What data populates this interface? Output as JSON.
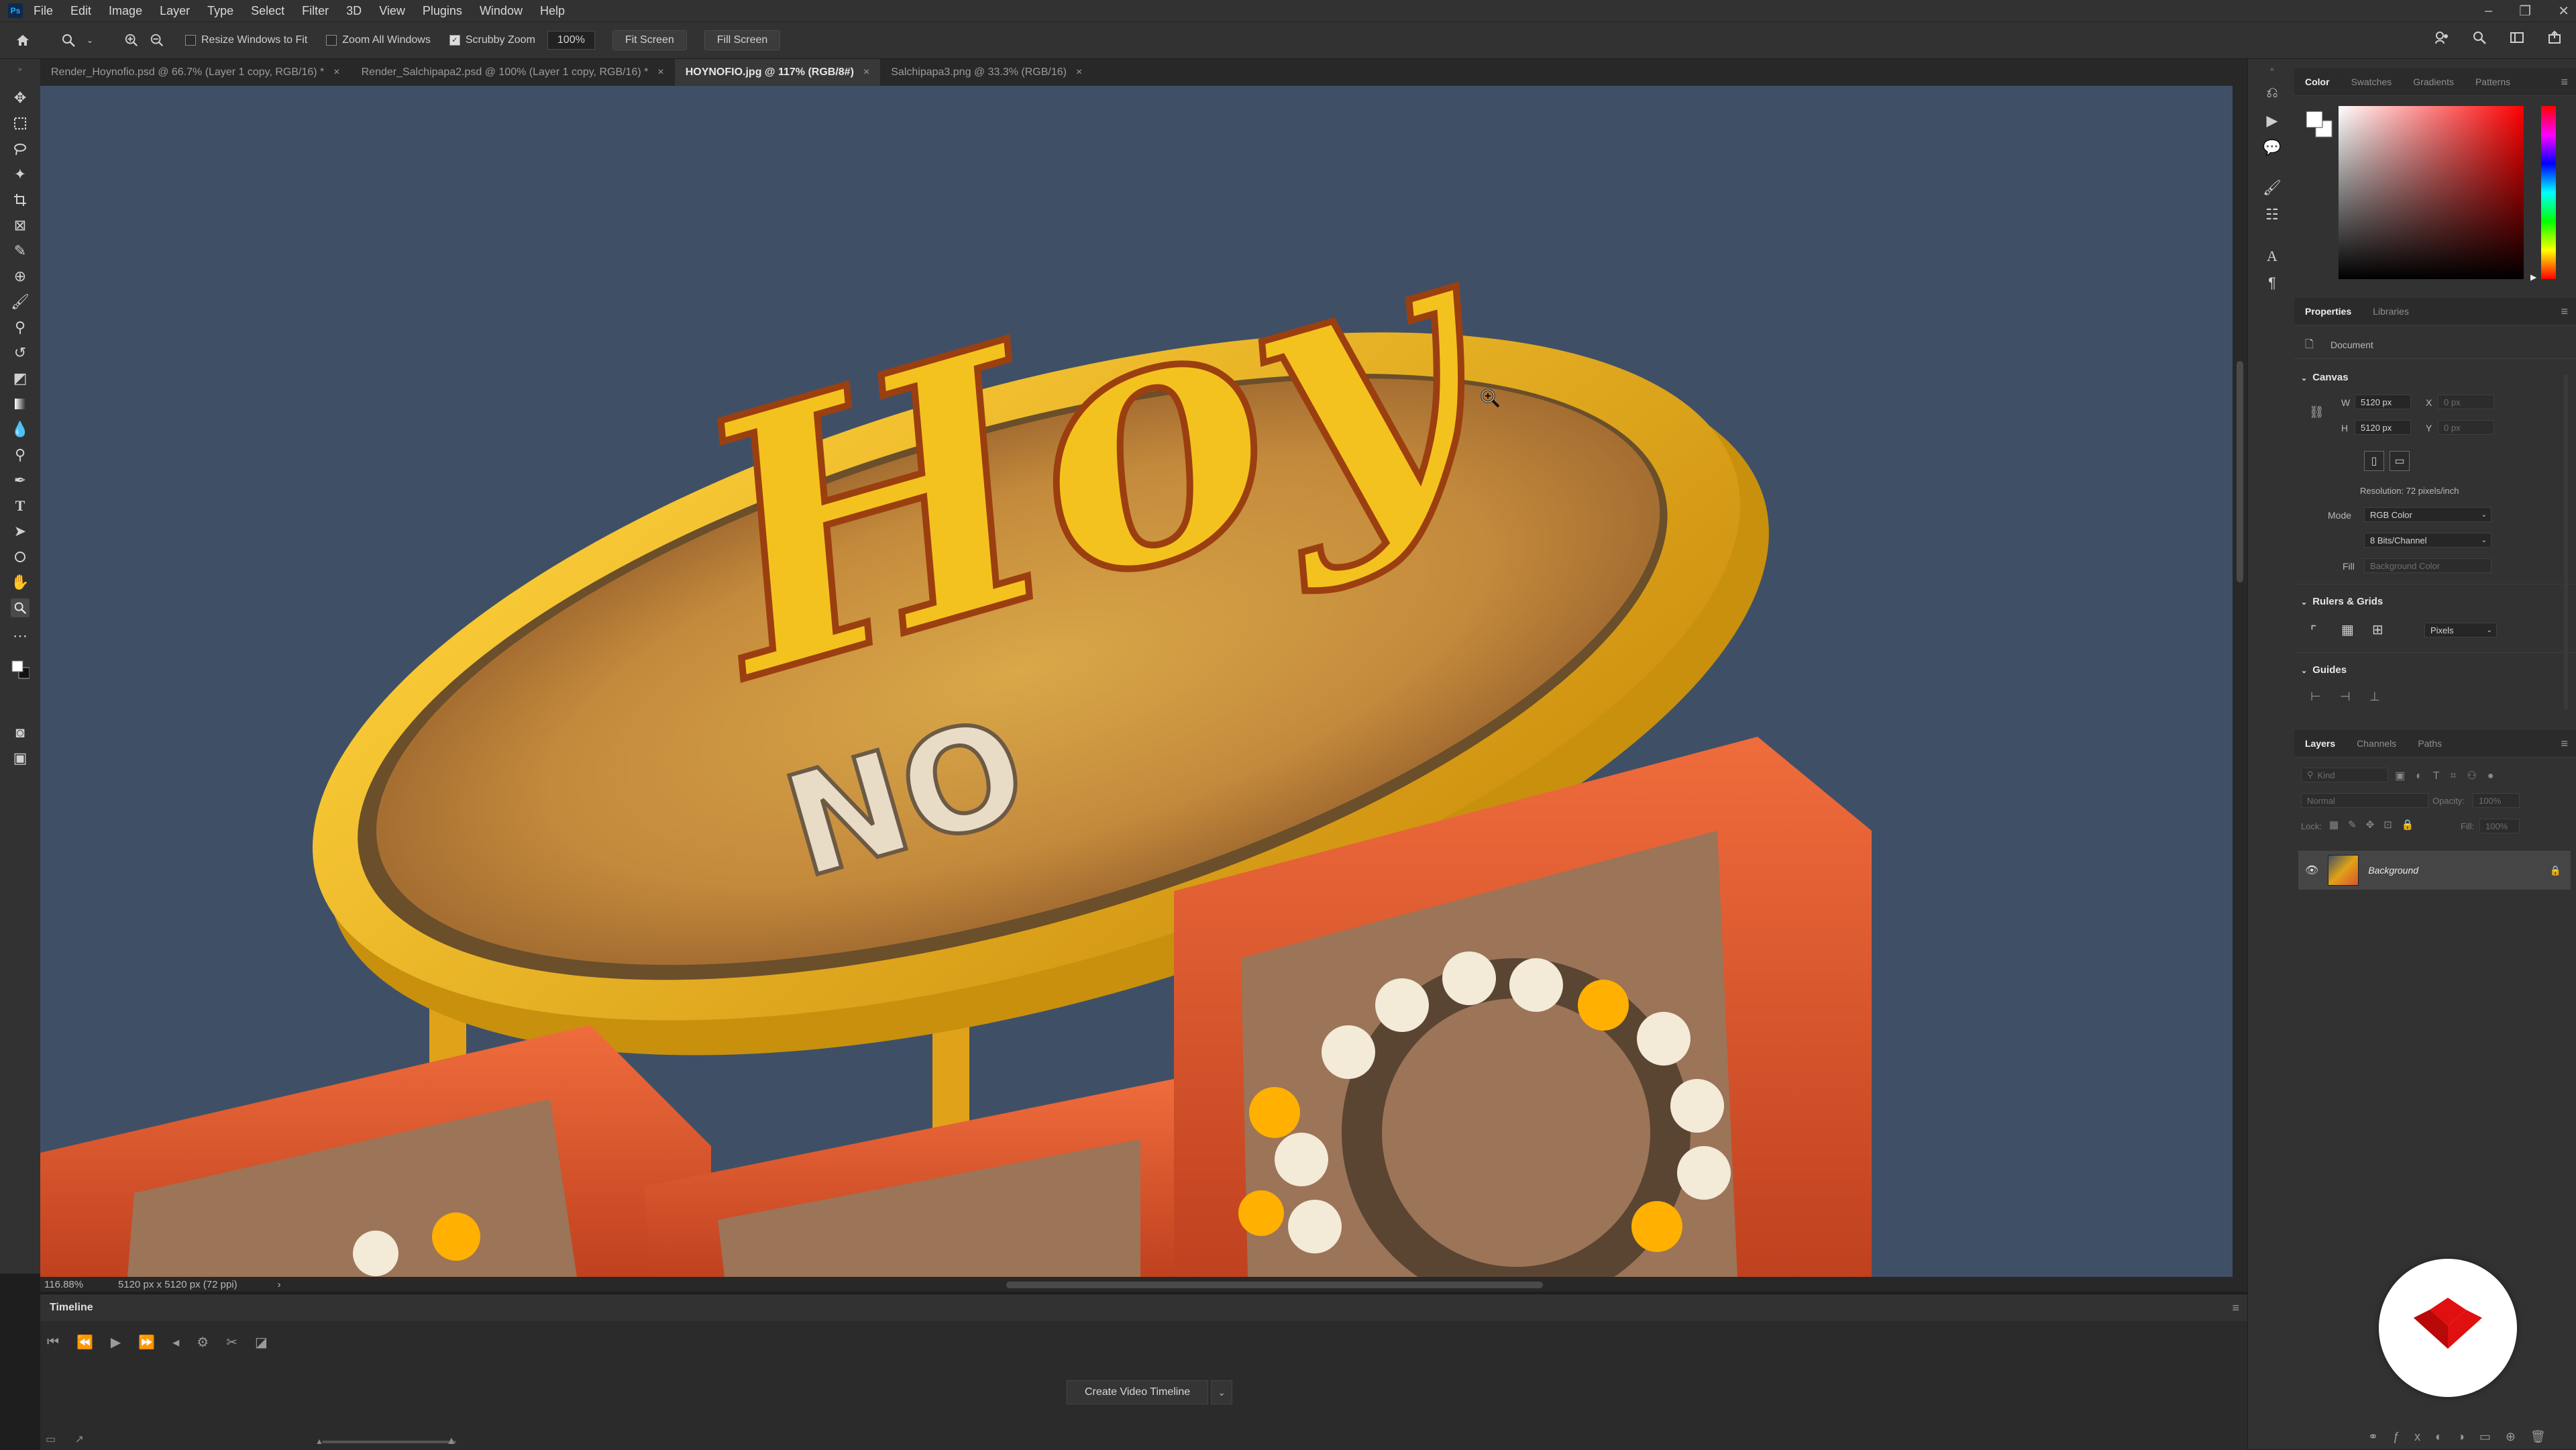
{
  "menu": {
    "logo": "Ps",
    "items": [
      "File",
      "Edit",
      "Image",
      "Layer",
      "Type",
      "Select",
      "Filter",
      "3D",
      "View",
      "Plugins",
      "Window",
      "Help"
    ]
  },
  "window_controls": {
    "minimize": "–",
    "restore": "❐",
    "close": "✕"
  },
  "options": {
    "resize_windows": "Resize Windows to Fit",
    "zoom_all": "Zoom All Windows",
    "scrubby_zoom": "Scrubby Zoom",
    "zoom_value": "100%",
    "fit_screen": "Fit Screen",
    "fill_screen": "Fill Screen"
  },
  "tabs": [
    {
      "label": "Render_Hoynofio.psd @ 66.7% (Layer 1 copy, RGB/16) *",
      "close": "×"
    },
    {
      "label": "Render_Salchipapa2.psd @ 100% (Layer 1 copy, RGB/16) *",
      "close": "×"
    },
    {
      "label": "HOYNOFIO.jpg @ 117% (RGB/8#)",
      "close": "×"
    },
    {
      "label": "Salchipapa3.png @ 33.3% (RGB/16)",
      "close": "×"
    }
  ],
  "artwork": {
    "word1": "Hoy",
    "word2": "NO"
  },
  "status": {
    "zoom": "116.88%",
    "doc_size": "5120 px x 5120 px (72 ppi)",
    "arrow": "›"
  },
  "timeline": {
    "title": "Timeline",
    "create_button": "Create Video Timeline",
    "dropdown": "⌄"
  },
  "color_panel": {
    "tabs": [
      "Color",
      "Swatches",
      "Gradients",
      "Patterns"
    ]
  },
  "properties": {
    "tabs": [
      "Properties",
      "Libraries"
    ],
    "doc_label": "Document",
    "canvas_section": "Canvas",
    "w_label": "W",
    "w_value": "5120 px",
    "h_label": "H",
    "h_value": "5120 px",
    "x_label": "X",
    "x_value": "0 px",
    "y_label": "Y",
    "y_value": "0 px",
    "resolution": "Resolution: 72 pixels/inch",
    "mode_label": "Mode",
    "mode_value": "RGB Color",
    "bits_value": "8 Bits/Channel",
    "fill_label": "Fill",
    "fill_value": "Background Color",
    "rulers_section": "Rulers & Grids",
    "units_value": "Pixels",
    "guides_section": "Guides"
  },
  "layers": {
    "tabs": [
      "Layers",
      "Channels",
      "Paths"
    ],
    "kind_placeholder": "Kind",
    "blend_mode": "Normal",
    "opacity_label": "Opacity:",
    "opacity_value": "100%",
    "lock_label": "Lock:",
    "fill_label": "Fill:",
    "fill_value": "100%",
    "layer_name": "Background"
  },
  "colors": {
    "accent": "#31a8ff",
    "sign_yellow": "#f2b81c",
    "sign_orange": "#e0532c",
    "sky": "#3f5066",
    "badge_red": "#e01010"
  }
}
